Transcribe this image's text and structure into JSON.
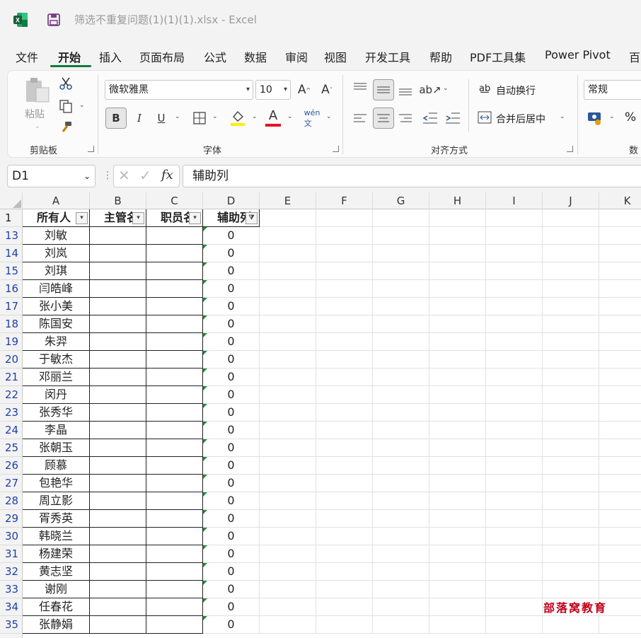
{
  "window": {
    "file_title": "筛选不重复问题(1)(1)(1).xlsx",
    "separator": " - ",
    "app_name": "Excel"
  },
  "ribbon_tabs": [
    "文件",
    "开始",
    "插入",
    "页面布局",
    "公式",
    "数据",
    "审阅",
    "视图",
    "开发工具",
    "帮助",
    "PDF工具集",
    "Power Pivot",
    "百"
  ],
  "active_tab": "开始",
  "clipboard": {
    "paste_label": "粘贴",
    "group_label": "剪贴板"
  },
  "font": {
    "font_name": "微软雅黑",
    "font_size": "10",
    "group_label": "字体",
    "font_color": "#e81123",
    "fill_color": "#ffee00"
  },
  "alignment": {
    "wrap_text": "自动换行",
    "merge_center": "合并后居中",
    "group_label": "对齐方式"
  },
  "number": {
    "format": "常规",
    "group_label": "数",
    "percent": "%"
  },
  "formula_bar": {
    "name_box": "D1",
    "fx": "fx",
    "content": "辅助列"
  },
  "columns": [
    "A",
    "B",
    "C",
    "D",
    "E",
    "F",
    "G",
    "H",
    "I",
    "J",
    "K"
  ],
  "header_row": {
    "row_num": "1",
    "cells": [
      "所有人",
      "主管名",
      "职员名",
      "辅助列"
    ]
  },
  "rows": [
    {
      "n": "13",
      "a": "刘敏",
      "d": "0"
    },
    {
      "n": "14",
      "a": "刘岚",
      "d": "0"
    },
    {
      "n": "15",
      "a": "刘琪",
      "d": "0"
    },
    {
      "n": "16",
      "a": "闫皓峰",
      "d": "0"
    },
    {
      "n": "17",
      "a": "张小美",
      "d": "0"
    },
    {
      "n": "18",
      "a": "陈国安",
      "d": "0"
    },
    {
      "n": "19",
      "a": "朱羿",
      "d": "0"
    },
    {
      "n": "20",
      "a": "于敏杰",
      "d": "0"
    },
    {
      "n": "21",
      "a": "邓丽兰",
      "d": "0"
    },
    {
      "n": "22",
      "a": "闵丹",
      "d": "0"
    },
    {
      "n": "23",
      "a": "张秀华",
      "d": "0"
    },
    {
      "n": "24",
      "a": "李晶",
      "d": "0"
    },
    {
      "n": "25",
      "a": "张朝玉",
      "d": "0"
    },
    {
      "n": "26",
      "a": "顾慕",
      "d": "0"
    },
    {
      "n": "27",
      "a": "包艳华",
      "d": "0"
    },
    {
      "n": "28",
      "a": "周立影",
      "d": "0"
    },
    {
      "n": "29",
      "a": "胥秀英",
      "d": "0"
    },
    {
      "n": "30",
      "a": "韩晓兰",
      "d": "0"
    },
    {
      "n": "31",
      "a": "杨建荣",
      "d": "0"
    },
    {
      "n": "32",
      "a": "黄志坚",
      "d": "0"
    },
    {
      "n": "33",
      "a": "谢刚",
      "d": "0"
    },
    {
      "n": "34",
      "a": "任春花",
      "d": "0"
    },
    {
      "n": "35",
      "a": "张静娟",
      "d": "0"
    }
  ],
  "watermark": "部落窝教育"
}
